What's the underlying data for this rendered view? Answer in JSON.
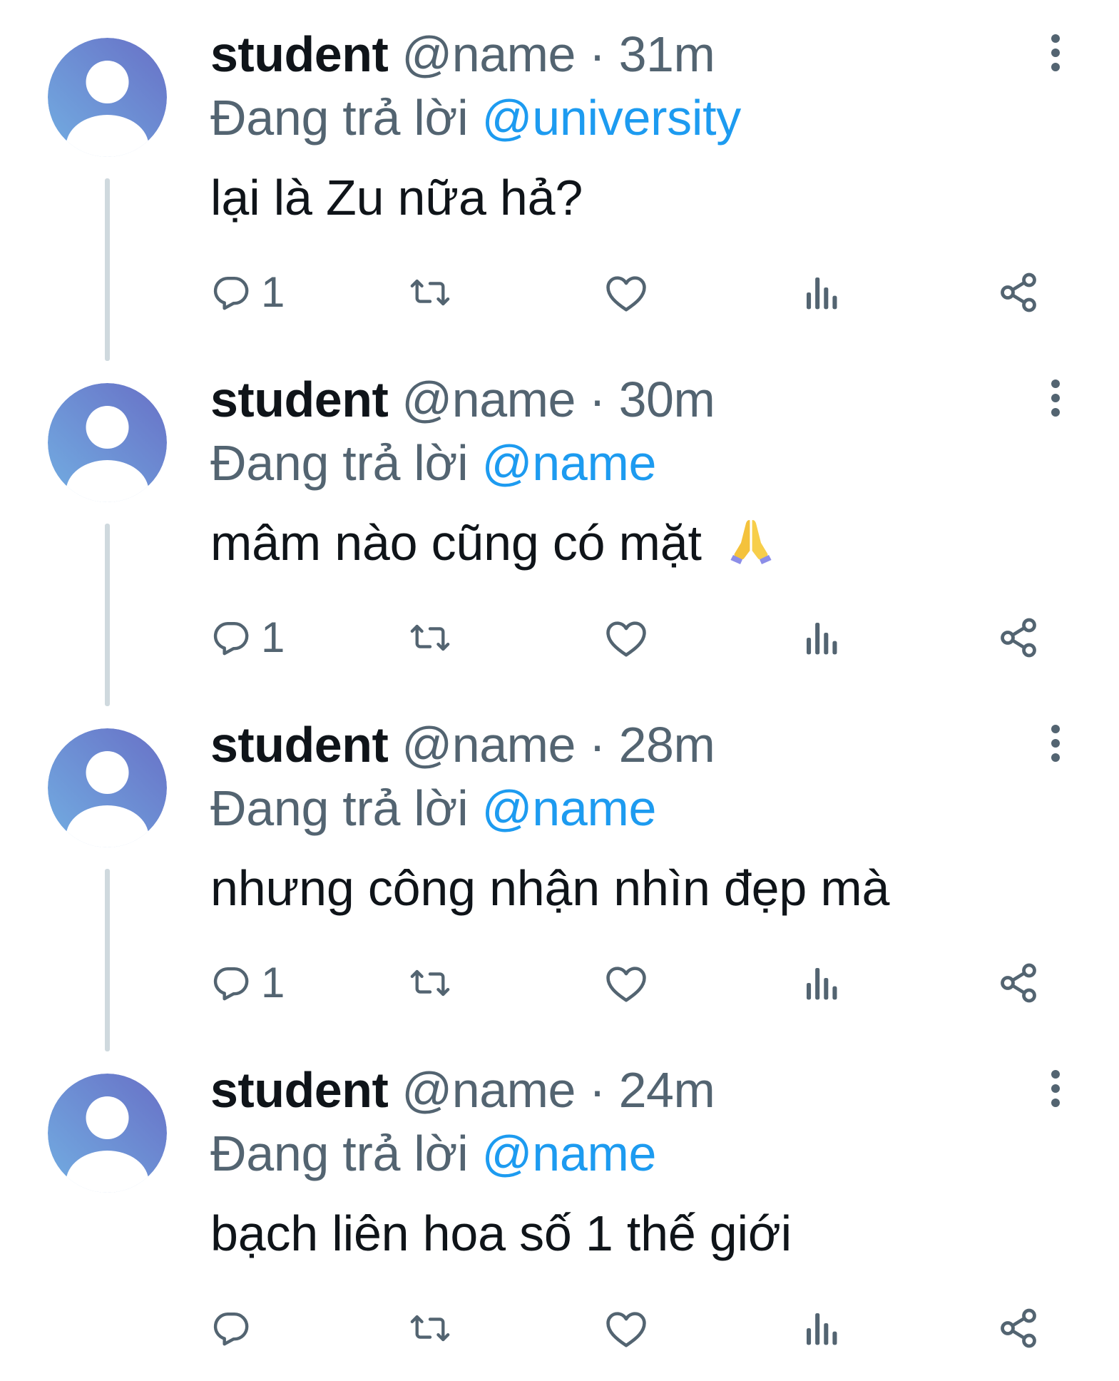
{
  "tweets": [
    {
      "display_name": "student",
      "handle": "@name",
      "separator": "·",
      "time": "31m",
      "replying_prefix": "Đang trả lời",
      "replying_to": "@university",
      "text": "lại là Zu nữa hả?",
      "emoji": "",
      "reply_count": "1",
      "icons": [
        "avatar-icon",
        "more-icon",
        "reply-icon",
        "retweet-icon",
        "like-icon",
        "views-icon",
        "share-icon"
      ]
    },
    {
      "display_name": "student",
      "handle": "@name",
      "separator": "·",
      "time": "30m",
      "replying_prefix": "Đang trả lời",
      "replying_to": "@name",
      "text": "mâm nào cũng có mặt",
      "emoji": "folded-hands-emoji",
      "reply_count": "1",
      "icons": [
        "avatar-icon",
        "more-icon",
        "reply-icon",
        "retweet-icon",
        "like-icon",
        "views-icon",
        "share-icon"
      ]
    },
    {
      "display_name": "student",
      "handle": "@name",
      "separator": "·",
      "time": "28m",
      "replying_prefix": "Đang trả lời",
      "replying_to": "@name",
      "text": "nhưng công nhận nhìn đẹp mà",
      "emoji": "",
      "reply_count": "1",
      "icons": [
        "avatar-icon",
        "more-icon",
        "reply-icon",
        "retweet-icon",
        "like-icon",
        "views-icon",
        "share-icon"
      ]
    },
    {
      "display_name": "student",
      "handle": "@name",
      "separator": "·",
      "time": "24m",
      "replying_prefix": "Đang trả lời",
      "replying_to": "@name",
      "text": "bạch liên hoa số 1 thế giới",
      "emoji": "",
      "reply_count": "",
      "icons": [
        "avatar-icon",
        "more-icon",
        "reply-icon",
        "retweet-icon",
        "like-icon",
        "views-icon",
        "share-icon"
      ]
    }
  ],
  "colors": {
    "text_primary": "#0f1419",
    "text_secondary": "#536471",
    "accent_link": "#1d9bf0",
    "thread_line": "#cfd9de",
    "avatar_gradient_start": "#6fa6de",
    "avatar_gradient_end": "#6a72c4"
  }
}
